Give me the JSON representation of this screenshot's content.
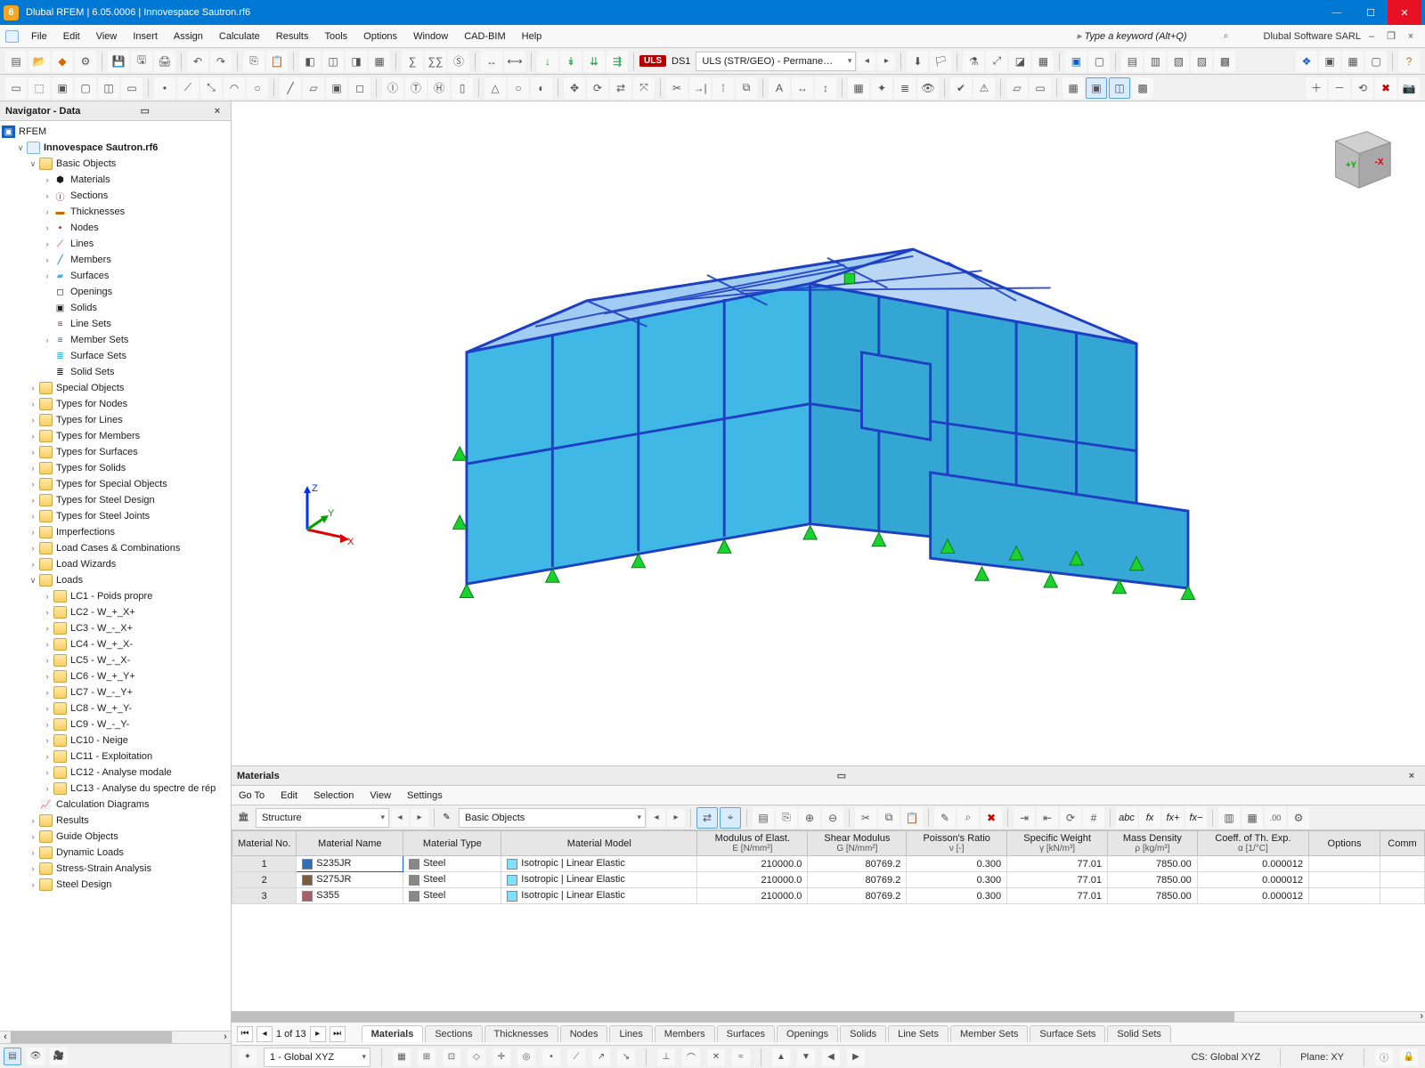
{
  "titlebar": {
    "app": "Dlubal RFEM",
    "version": "6.05.0006",
    "file": "Innovespace Sautron.rf6",
    "min": "—",
    "max": "☐",
    "close": "✕"
  },
  "menubar": {
    "items": [
      "File",
      "Edit",
      "View",
      "Insert",
      "Assign",
      "Calculate",
      "Results",
      "Tools",
      "Options",
      "Window",
      "CAD-BIM",
      "Help"
    ],
    "search_placeholder": "Type a keyword (Alt+Q)",
    "vendor": "Dlubal Software SARL"
  },
  "loadbar": {
    "uls_badge": "ULS",
    "lc_text": "DS1",
    "combo": "ULS (STR/GEO) - Permane…"
  },
  "navigator": {
    "title": "Navigator - Data",
    "root": "RFEM",
    "file": "Innovespace Sautron.rf6",
    "basic_objects": {
      "label": "Basic Objects",
      "children": [
        "Materials",
        "Sections",
        "Thicknesses",
        "Nodes",
        "Lines",
        "Members",
        "Surfaces",
        "Openings",
        "Solids",
        "Line Sets",
        "Member Sets",
        "Surface Sets",
        "Solid Sets"
      ]
    },
    "categories": [
      "Special Objects",
      "Types for Nodes",
      "Types for Lines",
      "Types for Members",
      "Types for Surfaces",
      "Types for Solids",
      "Types for Special Objects",
      "Types for Steel Design",
      "Types for Steel Joints",
      "Imperfections",
      "Load Cases & Combinations",
      "Load Wizards"
    ],
    "loads_label": "Loads",
    "loads": [
      "LC1 - Poids propre",
      "LC2 - W_+_X+",
      "LC3 - W_-_X+",
      "LC4 - W_+_X-",
      "LC5 - W_-_X-",
      "LC6 - W_+_Y+",
      "LC7 - W_-_Y+",
      "LC8 - W_+_Y-",
      "LC9 - W_-_Y-",
      "LC10 - Neige",
      "LC11 - Exploitation",
      "LC12 - Analyse modale",
      "LC13 - Analyse du spectre de rép"
    ],
    "after": [
      "Calculation Diagrams",
      "Results",
      "Guide Objects",
      "Dynamic Loads",
      "Stress-Strain Analysis",
      "Steel Design"
    ]
  },
  "materials_panel": {
    "title": "Materials",
    "menu": [
      "Go To",
      "Edit",
      "Selection",
      "View",
      "Settings"
    ],
    "structure_combo": "Structure",
    "group_combo": "Basic Objects",
    "headers": {
      "no": "Material\nNo.",
      "name": "Material Name",
      "type": "Material\nType",
      "model": "Material Model",
      "e": "Modulus of Elast.",
      "e_unit": "E [N/mm²]",
      "g": "Shear Modulus",
      "g_unit": "G [N/mm²]",
      "v": "Poisson's Ratio",
      "v_unit": "ν [-]",
      "w": "Specific Weight",
      "w_unit": "γ [kN/m³]",
      "d": "Mass Density",
      "d_unit": "ρ [kg/m³]",
      "a": "Coeff. of Th. Exp.",
      "a_unit": "α [1/°C]",
      "opt": "Options",
      "comm": "Comm"
    },
    "rows": [
      {
        "no": 1,
        "name": "S235JR",
        "swatch": "#2f6fb5",
        "type": "Steel",
        "model": "Isotropic | Linear Elastic",
        "e": "210000.0",
        "g": "80769.2",
        "v": "0.300",
        "w": "77.01",
        "d": "7850.00",
        "a": "0.000012"
      },
      {
        "no": 2,
        "name": "S275JR",
        "swatch": "#7a5c3e",
        "type": "Steel",
        "model": "Isotropic | Linear Elastic",
        "e": "210000.0",
        "g": "80769.2",
        "v": "0.300",
        "w": "77.01",
        "d": "7850.00",
        "a": "0.000012"
      },
      {
        "no": 3,
        "name": "S355",
        "swatch": "#a85f6a",
        "type": "Steel",
        "model": "Isotropic | Linear Elastic",
        "e": "210000.0",
        "g": "80769.2",
        "v": "0.300",
        "w": "77.01",
        "d": "7850.00",
        "a": "0.000012"
      }
    ],
    "pager": "1 of 13",
    "tabs": [
      "Materials",
      "Sections",
      "Thicknesses",
      "Nodes",
      "Lines",
      "Members",
      "Surfaces",
      "Openings",
      "Solids",
      "Line Sets",
      "Member Sets",
      "Surface Sets",
      "Solid Sets"
    ]
  },
  "statusbar": {
    "cs_select": "1 - Global XYZ",
    "cs": "CS: Global XYZ",
    "plane": "Plane: XY"
  },
  "axes": {
    "x": "X",
    "y": "Y",
    "z": "Z"
  }
}
